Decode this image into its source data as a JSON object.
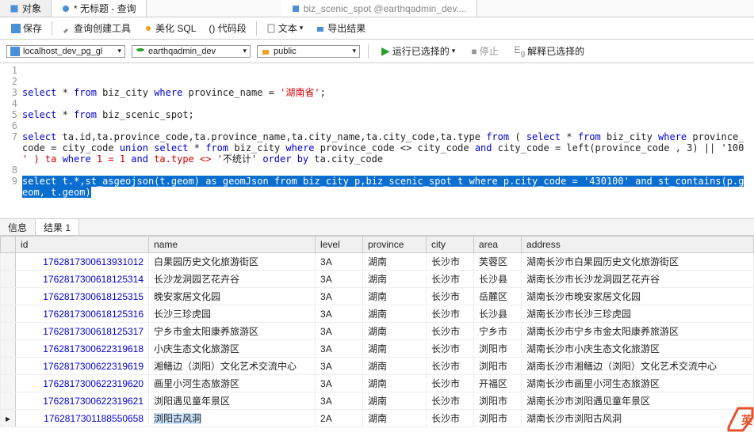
{
  "top_tabs": {
    "t1": "对象",
    "t2": "* 无标题 - 查询",
    "t3": "biz_scenic_spot @earthqadmin_dev...."
  },
  "toolbar": {
    "save": "保存",
    "builder": "查询创建工具",
    "beautify": "美化 SQL",
    "snippet": "() 代码段",
    "text": "文本",
    "export": "导出结果"
  },
  "conn": {
    "server": "localhost_dev_pg_gl",
    "db": "earthqadmin_dev",
    "schema": "public",
    "run": "运行已选择的",
    "stop": "停止",
    "explain": "解释已选择的"
  },
  "sql": {
    "l1": "",
    "l2": "",
    "l3": {
      "a": "select",
      "b": " * ",
      "c": "from",
      "d": " biz_city ",
      "e": "where",
      "f": " province_name = ",
      "g": "'湖南省'",
      "h": ";"
    },
    "l4": "",
    "l5": {
      "a": "select",
      "b": " * ",
      "c": "from",
      "d": " biz_scenic_spot;"
    },
    "l6": "",
    "l7": "select ta.id,ta.province_code,ta.province_name,ta.city_name,ta.city_code,ta.type from ( select * from biz_city where province_code = city_code union select * from biz_city where province_code <> city_code and city_code = left(province_code , 3) || '100' ) ta where 1 = 1 and ta.type <> '不统计' order by ta.city_code",
    "l8": "",
    "l9": {
      "a": "select t.*,st_asgeojson(t.geom) as geomJson from biz_city p,biz_scenic_spot t where p.city_code = '430100' and st_contains(p.geom, t.geom)"
    }
  },
  "result_tabs": {
    "info": "信息",
    "r1": "结果 1"
  },
  "cols": {
    "id": "id",
    "name": "name",
    "level": "level",
    "province": "province",
    "city": "city",
    "area": "area",
    "address": "address"
  },
  "chart_data": {
    "type": "table",
    "columns": [
      "id",
      "name",
      "level",
      "province",
      "city",
      "area",
      "address"
    ],
    "rows": [
      {
        "id": "17628173006139310​12",
        "name": "白果园历史文化旅游街区",
        "level": "3A",
        "province": "湖南",
        "city": "长沙市",
        "area": "芙蓉区",
        "address": "湖南长沙市白果园历史文化旅游街区"
      },
      {
        "id": "17628173006181253​14",
        "name": "长沙龙洞园艺花卉谷",
        "level": "3A",
        "province": "湖南",
        "city": "长沙市",
        "area": "长沙县",
        "address": "湖南长沙市长沙龙洞园艺花卉谷"
      },
      {
        "id": "17628173006181253​15",
        "name": "晚安家居文化园",
        "level": "3A",
        "province": "湖南",
        "city": "长沙市",
        "area": "岳麓区",
        "address": "湖南长沙市晚安家居文化园"
      },
      {
        "id": "17628173006181253​16",
        "name": "长沙三珍虎园",
        "level": "3A",
        "province": "湖南",
        "city": "长沙市",
        "area": "长沙县",
        "address": "湖南长沙市长沙三珍虎园"
      },
      {
        "id": "17628173006181253​17",
        "name": "宁乡市金太阳康养旅游区",
        "level": "3A",
        "province": "湖南",
        "city": "长沙市",
        "area": "宁乡市",
        "address": "湖南长沙市宁乡市金太阳康养旅游区"
      },
      {
        "id": "17628173006223196​18",
        "name": "小庆生态文化旅游区",
        "level": "3A",
        "province": "湖南",
        "city": "长沙市",
        "area": "浏阳市",
        "address": "湖南长沙市小庆生态文化旅游区"
      },
      {
        "id": "17628173006223196​19",
        "name": "湘鳝边（浏阳）文化艺术交流中心",
        "level": "3A",
        "province": "湖南",
        "city": "长沙市",
        "area": "浏阳市",
        "address": "湖南长沙市湘鳝边（浏阳）文化艺术交流中心"
      },
      {
        "id": "17628173006223196​20",
        "name": "画里小河生态旅游区",
        "level": "3A",
        "province": "湖南",
        "city": "长沙市",
        "area": "开福区",
        "address": "湖南长沙市画里小河生态旅游区"
      },
      {
        "id": "17628173006223196​21",
        "name": "浏阳遇见童年景区",
        "level": "3A",
        "province": "湖南",
        "city": "长沙市",
        "area": "浏阳市",
        "address": "湖南长沙市浏阳遇见童年景区"
      },
      {
        "id": "17628173011885506​58",
        "name": "浏阳古风洞",
        "level": "2A",
        "province": "湖南",
        "city": "长沙市",
        "area": "浏阳市",
        "address": "湖南长沙市浏阳古风洞"
      }
    ]
  }
}
